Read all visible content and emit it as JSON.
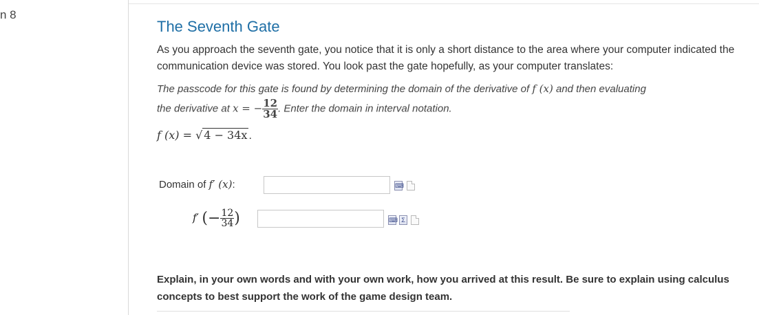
{
  "question_label": "n 8",
  "title": "The Seventh Gate",
  "intro": "As you approach the seventh gate, you notice that it is only a short distance to the area where your computer indicated the communication device was stored. You look past the gate hopefully, as your computer translates:",
  "prompt": {
    "part1": "The passcode for this gate is found by determining the domain of the derivative of ",
    "part2": " and then evaluating",
    "part3": "the derivative at ",
    "part4": ". Enter the domain in interval notation.",
    "fx": "f (x)",
    "x_eq": "x = −",
    "frac_num": "12",
    "frac_den": "34"
  },
  "function": {
    "lhs": "f (x) = ",
    "radicand": "4 − 34x",
    "end": "."
  },
  "answers": {
    "domain_label_prefix": "Domain of ",
    "domain_label_f": "f′ (x)",
    "domain_label_suffix": ":",
    "domain_value": "",
    "deriv_label_f": "f′",
    "deriv_open": "(−",
    "deriv_num": "12",
    "deriv_den": "34",
    "deriv_close": ")",
    "deriv_value": ""
  },
  "icons": {
    "domain": [
      "equation-editor-icon",
      "page-icon"
    ],
    "deriv": [
      "equation-editor-icon",
      "sigma-icon",
      "page-icon"
    ]
  },
  "explain": "Explain, in your own words and with your own work, how you arrived at this result. Be sure to explain using calculus concepts to best support the work of the game design team.",
  "colors": {
    "title": "#1f6fa6",
    "text": "#333333",
    "border": "#c7c7c7"
  }
}
